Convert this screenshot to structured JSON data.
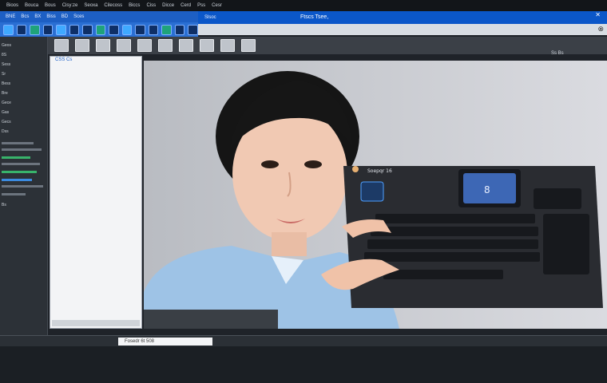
{
  "menubar": {
    "items": [
      "Bioos",
      "Bouca",
      "Bous",
      "Cisy:ze",
      "Seoxa",
      "Cilecoss",
      "Biccs",
      "Ciss",
      "Dicce",
      "Cerd",
      "Pss",
      "Cesr"
    ]
  },
  "blue_panel": {
    "tabs": [
      "BNE",
      "Bcs",
      "BX",
      "Biss",
      "BD",
      "Sces"
    ]
  },
  "title_area": {
    "label": "Slsoc",
    "window_title": "Ftscs Tsee,"
  },
  "file_panel": {
    "header": "CSS Cs"
  },
  "status": {
    "field": "Fosedr 6t 508"
  },
  "canvas": {
    "info": "Ss Bs"
  },
  "keyboard": {
    "label": "Soepqr 16"
  },
  "sidebar": {
    "items": [
      "Geos",
      "8S",
      "Sess",
      "Sr",
      "Bess",
      "Bre",
      "Gece",
      "Gas",
      "Gecs",
      "Dss",
      "Bs"
    ]
  }
}
